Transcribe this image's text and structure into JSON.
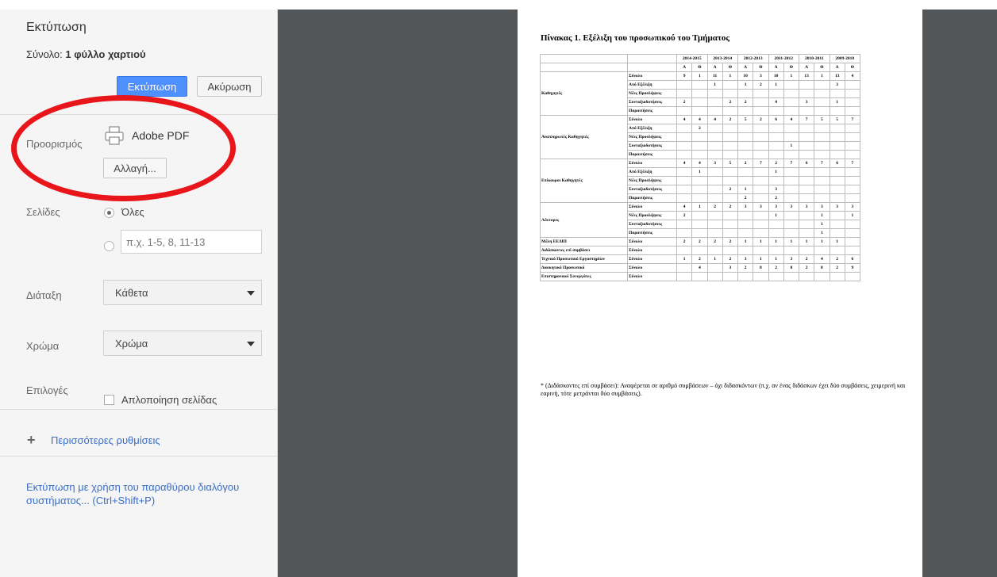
{
  "panel": {
    "title": "Εκτύπωση",
    "summary_label": "Σύνολο:",
    "summary_value": "1 φύλλο χαρτιού",
    "print_button": "Εκτύπωση",
    "cancel_button": "Ακύρωση",
    "destination_label": "Προορισμός",
    "printer_name": "Adobe PDF",
    "change_button": "Αλλαγή...",
    "pages_label": "Σελίδες",
    "pages_all": "Όλες",
    "pages_placeholder": "π.χ. 1-5, 8, 11-13",
    "layout_label": "Διάταξη",
    "layout_value": "Κάθετα",
    "color_label": "Χρώμα",
    "color_value": "Χρώμα",
    "options_label": "Επιλογές",
    "simplify_label": "Απλοποίηση σελίδας",
    "more_settings": "Περισσότερες ρυθμίσεις",
    "system_dialog": "Εκτύπωση με χρήση του παραθύρου διαλόγου συστήματος... (Ctrl+Shift+P)"
  },
  "preview": {
    "title": "Πίνακας 1. Εξέλιξη του προσωπικού του Τμήματος",
    "years": [
      "2014-2015",
      "2013-2014",
      "2012-2013",
      "2011-2012",
      "2010-2011",
      "2009-2010"
    ],
    "subheaders": [
      "Α",
      "Θ",
      "Α",
      "Θ",
      "Α",
      "Θ",
      "Α",
      "Θ",
      "Α",
      "Θ",
      "Α",
      "Θ"
    ],
    "groups": [
      {
        "name": "Καθηγητές",
        "rows": [
          {
            "label": "Σύνολο",
            "values": [
              "9",
              "1",
              "11",
              "1",
              "10",
              "3",
              "10",
              "1",
              "13",
              "1",
              "13",
              "4"
            ]
          },
          {
            "label": "Από Εξέλιξη",
            "values": [
              "",
              "",
              "1",
              "",
              "1",
              "2",
              "1",
              "",
              "",
              "",
              "3",
              ""
            ]
          },
          {
            "label": "Νέες Προσλήψεις",
            "values": [
              "",
              "",
              "",
              "",
              "",
              "",
              "",
              "",
              "",
              "",
              "",
              ""
            ]
          },
          {
            "label": "Συνταξιοδοτήσεις",
            "values": [
              "2",
              "",
              "",
              "2",
              "2",
              "",
              "4",
              "",
              "3",
              "",
              "1",
              ""
            ]
          },
          {
            "label": "Παραιτήσεις",
            "values": [
              "",
              "",
              "",
              "",
              "",
              "",
              "",
              "",
              "",
              "",
              "",
              ""
            ]
          }
        ]
      },
      {
        "name": "Αναπληρωτές Καθηγητές",
        "rows": [
          {
            "label": "Σύνολο",
            "values": [
              "4",
              "4",
              "4",
              "2",
              "5",
              "2",
              "6",
              "4",
              "7",
              "5",
              "5",
              "7"
            ]
          },
          {
            "label": "Από Εξέλιξη",
            "values": [
              "",
              "2",
              "",
              "",
              "",
              "",
              "",
              "",
              "",
              "",
              "",
              ""
            ]
          },
          {
            "label": "Νέες Προσλήψεις",
            "values": [
              "",
              "",
              "",
              "",
              "",
              "",
              "",
              "",
              "",
              "",
              "",
              ""
            ]
          },
          {
            "label": "Συνταξιοδοτήσεις",
            "values": [
              "",
              "",
              "",
              "",
              "",
              "",
              "",
              "1",
              "",
              "",
              "",
              ""
            ]
          },
          {
            "label": "Παραιτήσεις",
            "values": [
              "",
              "",
              "",
              "",
              "",
              "",
              "",
              "",
              "",
              "",
              "",
              ""
            ]
          }
        ]
      },
      {
        "name": "Επίκουροι Καθηγητές",
        "rows": [
          {
            "label": "Σύνολο",
            "values": [
              "4",
              "4",
              "3",
              "5",
              "2",
              "7",
              "2",
              "7",
              "6",
              "7",
              "6",
              "7"
            ]
          },
          {
            "label": "Από Εξέλιξη",
            "values": [
              "",
              "1",
              "",
              "",
              "",
              "",
              "1",
              "",
              "",
              "",
              "",
              ""
            ]
          },
          {
            "label": "Νέες Προσλήψεις",
            "values": [
              "",
              "",
              "",
              "",
              "",
              "",
              "",
              "",
              "",
              "",
              "",
              ""
            ]
          },
          {
            "label": "Συνταξιοδοτήσεις",
            "values": [
              "",
              "",
              "",
              "2",
              "1",
              "",
              "3",
              "",
              "",
              "",
              "",
              ""
            ]
          },
          {
            "label": "Παραιτήσεις",
            "values": [
              "",
              "",
              "",
              "",
              "2",
              "",
              "2",
              "",
              "",
              "",
              "",
              ""
            ]
          }
        ]
      },
      {
        "name": "Λέκτορες",
        "rows": [
          {
            "label": "Σύνολο",
            "values": [
              "4",
              "1",
              "2",
              "2",
              "3",
              "3",
              "3",
              "3",
              "3",
              "3",
              "3",
              "3"
            ]
          },
          {
            "label": "Νέες Προσλήψεις",
            "values": [
              "2",
              "",
              "",
              "",
              "",
              "",
              "1",
              "",
              "",
              "1",
              "",
              "1"
            ]
          },
          {
            "label": "Συνταξιοδοτήσεις",
            "values": [
              "",
              "",
              "",
              "",
              "",
              "",
              "",
              "",
              "",
              "1",
              "",
              ""
            ]
          },
          {
            "label": "Παραιτήσεις",
            "values": [
              "",
              "",
              "",
              "",
              "",
              "",
              "",
              "",
              "",
              "1",
              "",
              ""
            ]
          }
        ]
      },
      {
        "name": "Μέλη ΕΕΔΙΠ",
        "rows": [
          {
            "label": "Σύνολο",
            "values": [
              "2",
              "2",
              "2",
              "2",
              "1",
              "1",
              "1",
              "1",
              "1",
              "1",
              "1",
              ""
            ]
          }
        ]
      },
      {
        "name": "Διδάσκοντες επί συμβάσει",
        "rows": [
          {
            "label": "Σύνολο",
            "values": [
              "",
              "",
              "",
              "",
              "",
              "",
              "",
              "",
              "",
              "",
              "",
              ""
            ]
          }
        ]
      },
      {
        "name": "Τεχνικό Προσωπικό Εργαστηρίων",
        "rows": [
          {
            "label": "Σύνολο",
            "values": [
              "1",
              "2",
              "1",
              "2",
              "3",
              "1",
              "1",
              "3",
              "2",
              "4",
              "2",
              "6"
            ]
          }
        ]
      },
      {
        "name": "Διοικητικό Προσωπικό",
        "rows": [
          {
            "label": "Σύνολο",
            "values": [
              "",
              "4",
              "",
              "3",
              "2",
              "8",
              "2",
              "8",
              "2",
              "8",
              "2",
              "9"
            ]
          }
        ]
      },
      {
        "name": "Επιστημονικοί Συνεργάτες",
        "rows": [
          {
            "label": "Σύνολο",
            "values": [
              "",
              "",
              "",
              "",
              "",
              "",
              "",
              "",
              "",
              "",
              "",
              ""
            ]
          }
        ]
      }
    ],
    "footnote": "* (Διδάσκοντες επί συμβάσει): Αναφέρεται σε αριθμό συμβάσεων – όχι διδασκόντων (π.χ. αν ένας διδάσκων έχει δύο συμβάσεις, χειμερινή και εαρινή, τότε μετράνται δύο συμβάσεις)."
  },
  "colors": {
    "accent": "#4d90fe",
    "annotation": "#e8151b",
    "link": "#3b6ec5",
    "viewer_bg": "#525659"
  }
}
